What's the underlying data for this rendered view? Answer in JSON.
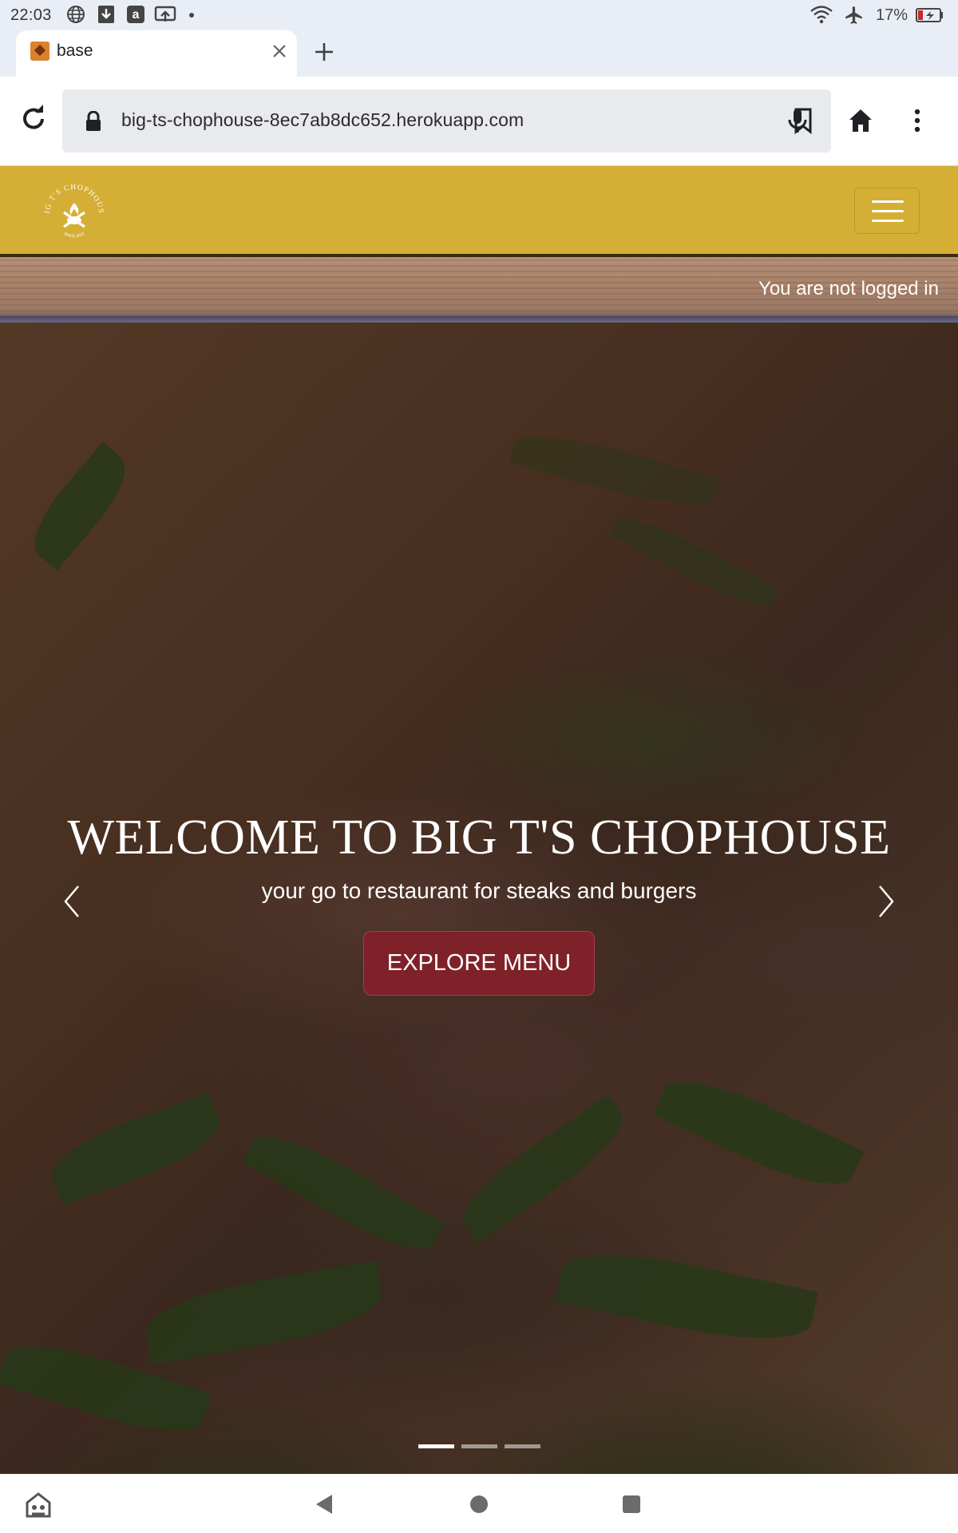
{
  "status_bar": {
    "time": "22:03",
    "battery": "17%",
    "icons": [
      "globe-icon",
      "download-icon",
      "amazon-icon",
      "cast-icon",
      "dot-icon",
      "wifi-icon",
      "airplane-icon",
      "battery-icon"
    ]
  },
  "browser": {
    "tab_title": "base",
    "url": "big-ts-chophouse-8ec7ab8dc652.herokuapp.com",
    "icons": [
      "favicon-icon",
      "close-icon",
      "plus-icon",
      "reload-icon",
      "lock-icon",
      "bookmark-icon",
      "microphone-icon",
      "home-icon",
      "more-vert-icon"
    ]
  },
  "site": {
    "logo_text": "BIG T'S CHOPHOUSE",
    "logo_since": "SINCE 2021",
    "login_status": "You are not logged in",
    "brand_color": "#d5ae35",
    "accent_color": "#7f2129"
  },
  "hero": {
    "title": "WELCOME TO BIG T'S CHOPHOUSE",
    "subtitle": "your go to restaurant for steaks and burgers",
    "cta": "EXPLORE MENU",
    "slides_total": 3,
    "active_slide": 1
  },
  "nav_bar": {
    "icons": [
      "assistant-icon",
      "back-icon",
      "home-circle-icon",
      "recents-icon"
    ]
  }
}
